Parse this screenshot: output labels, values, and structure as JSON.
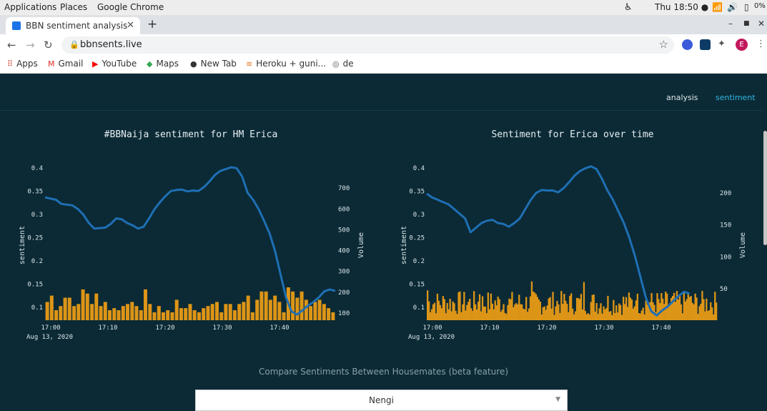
{
  "os_bar": {
    "applications": "Applications",
    "places": "Places",
    "browser": "Google Chrome",
    "clock": "Thu 18:50 ●",
    "battery": "0%"
  },
  "browser": {
    "tab_title": "BBN sentiment analysis",
    "url": "bbnsents.live",
    "profile_initial": "E",
    "bookmarks": [
      "Apps",
      "Gmail",
      "YouTube",
      "Maps",
      "New Tab",
      "Heroku + guni...",
      "de"
    ]
  },
  "site": {
    "nav": [
      "analysis",
      "sentiment"
    ],
    "compare_label": "Compare Sentiments Between Housemates (beta feature)",
    "dropdown_value": "Nengi"
  },
  "colors": {
    "background": "#0b2a35",
    "line": "#1f6fb4",
    "bars": "#dd9517",
    "active_tab": "#33b5e5"
  },
  "chart_data": [
    {
      "type": "line+bar",
      "title": "#BBNaija sentiment for HM Erica",
      "ylabel": "sentiment",
      "y2label": "Volume",
      "xticks": [
        "17:00",
        "17:10",
        "17:20",
        "17:30",
        "17:40"
      ],
      "date_label": "Aug 13, 2020",
      "yticks": [
        "0.1",
        "0.15",
        "0.2",
        "0.25",
        "0.3",
        "0.35",
        "0.4"
      ],
      "y2ticks": [
        "100",
        "200",
        "300",
        "400",
        "500",
        "600",
        "700"
      ],
      "ylim": [
        0.08,
        0.41
      ],
      "y2lim": [
        62,
        800
      ],
      "line": [
        [
          0,
          0.335
        ],
        [
          2,
          0.33
        ],
        [
          3,
          0.321
        ],
        [
          5,
          0.318
        ],
        [
          6,
          0.31
        ],
        [
          7,
          0.298
        ],
        [
          8,
          0.28
        ],
        [
          9,
          0.268
        ],
        [
          10,
          0.269
        ],
        [
          11,
          0.27
        ],
        [
          12,
          0.278
        ],
        [
          13,
          0.29
        ],
        [
          14,
          0.288
        ],
        [
          15,
          0.28
        ],
        [
          16,
          0.275
        ],
        [
          17,
          0.268
        ],
        [
          18,
          0.272
        ],
        [
          19,
          0.29
        ],
        [
          20,
          0.31
        ],
        [
          21,
          0.325
        ],
        [
          22,
          0.338
        ],
        [
          23,
          0.349
        ],
        [
          24,
          0.351
        ],
        [
          25,
          0.352
        ],
        [
          26,
          0.348
        ],
        [
          27,
          0.35
        ],
        [
          28,
          0.349
        ],
        [
          29,
          0.357
        ],
        [
          30,
          0.369
        ],
        [
          31,
          0.383
        ],
        [
          32,
          0.392
        ],
        [
          33,
          0.396
        ],
        [
          34,
          0.4
        ],
        [
          35,
          0.398
        ],
        [
          36,
          0.38
        ],
        [
          37,
          0.345
        ],
        [
          38,
          0.33
        ],
        [
          39,
          0.31
        ],
        [
          40,
          0.285
        ],
        [
          41,
          0.258
        ],
        [
          42,
          0.22
        ],
        [
          43,
          0.17
        ],
        [
          44,
          0.12
        ],
        [
          45,
          0.09
        ],
        [
          46,
          0.083
        ],
        [
          47,
          0.092
        ],
        [
          48,
          0.102
        ],
        [
          49,
          0.11
        ],
        [
          50,
          0.12
        ],
        [
          51,
          0.133
        ],
        [
          52,
          0.137
        ],
        [
          53,
          0.134
        ]
      ],
      "bar_values": [
        150,
        180,
        110,
        130,
        170,
        170,
        130,
        140,
        210,
        190,
        140,
        190,
        130,
        150,
        110,
        120,
        110,
        130,
        140,
        150,
        130,
        110,
        210,
        140,
        100,
        130,
        100,
        110,
        100,
        160,
        120,
        120,
        140,
        110,
        100,
        120,
        130,
        140,
        150,
        100,
        140,
        140,
        110,
        140,
        150,
        180,
        100,
        160,
        200,
        200,
        160,
        180,
        150,
        100,
        220,
        200,
        170,
        200,
        160,
        130,
        150,
        160,
        140,
        120,
        100
      ],
      "x_start": 0,
      "x_step": 0.84
    },
    {
      "type": "line+bar",
      "title": "Sentiment for Erica over time",
      "ylabel": "sentiment",
      "y2label": "Volume",
      "xticks": [
        "17:00",
        "17:10",
        "17:20",
        "17:30",
        "17:40"
      ],
      "date_label": "Aug 13, 2020",
      "yticks": [
        "0.1",
        "0.15",
        "0.2",
        "0.25",
        "0.3",
        "0.35",
        "0.4"
      ],
      "y2ticks": [
        "50",
        "100",
        "150",
        "200"
      ],
      "ylim": [
        0.08,
        0.41
      ],
      "y2lim": [
        0,
        240
      ],
      "line": [
        [
          0,
          0.343
        ],
        [
          1,
          0.335
        ],
        [
          2,
          0.33
        ],
        [
          3,
          0.325
        ],
        [
          4,
          0.32
        ],
        [
          5,
          0.31
        ],
        [
          6,
          0.3
        ],
        [
          7,
          0.29
        ],
        [
          8,
          0.26
        ],
        [
          9,
          0.27
        ],
        [
          10,
          0.28
        ],
        [
          11,
          0.285
        ],
        [
          12,
          0.287
        ],
        [
          13,
          0.28
        ],
        [
          14,
          0.278
        ],
        [
          15,
          0.272
        ],
        [
          16,
          0.28
        ],
        [
          17,
          0.29
        ],
        [
          18,
          0.31
        ],
        [
          19,
          0.33
        ],
        [
          20,
          0.345
        ],
        [
          21,
          0.351
        ],
        [
          22,
          0.35
        ],
        [
          23,
          0.35
        ],
        [
          24,
          0.346
        ],
        [
          25,
          0.355
        ],
        [
          26,
          0.368
        ],
        [
          27,
          0.382
        ],
        [
          28,
          0.392
        ],
        [
          29,
          0.398
        ],
        [
          30,
          0.402
        ],
        [
          31,
          0.396
        ],
        [
          32,
          0.375
        ],
        [
          33,
          0.35
        ],
        [
          34,
          0.33
        ],
        [
          35,
          0.305
        ],
        [
          36,
          0.28
        ],
        [
          37,
          0.248
        ],
        [
          38,
          0.21
        ],
        [
          39,
          0.165
        ],
        [
          40,
          0.12
        ],
        [
          41,
          0.09
        ],
        [
          42,
          0.081
        ],
        [
          43,
          0.092
        ],
        [
          44,
          0.1
        ],
        [
          45,
          0.112
        ],
        [
          46,
          0.123
        ],
        [
          47,
          0.132
        ],
        [
          48,
          0.128
        ]
      ],
      "bar_values": [],
      "x_start": 0,
      "x_step": 0.26
    }
  ]
}
